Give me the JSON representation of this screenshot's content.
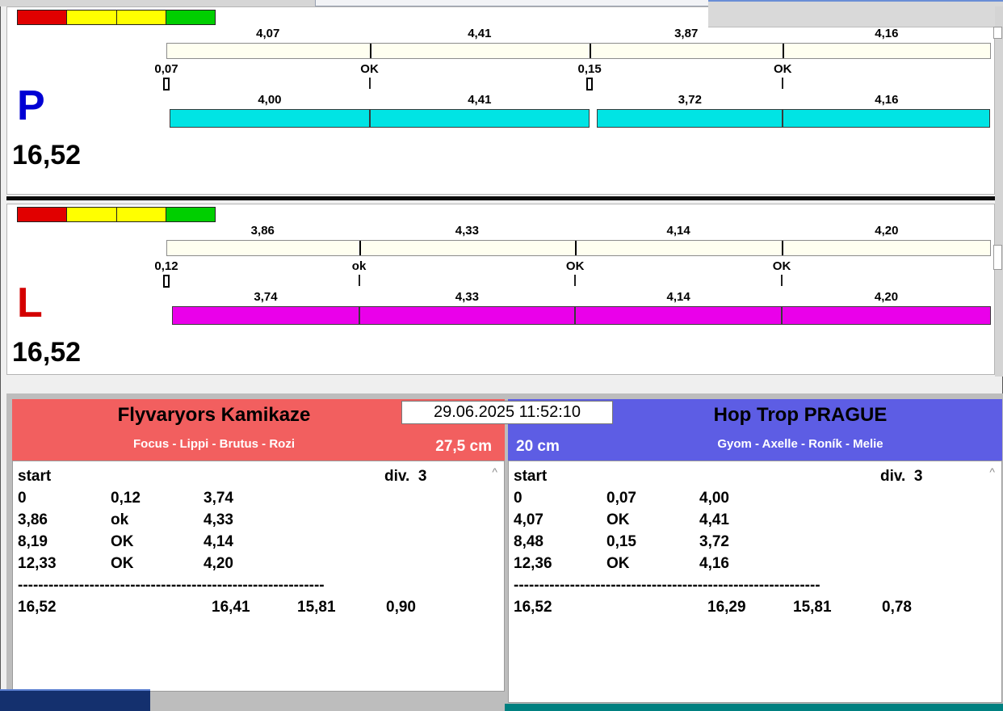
{
  "ui": {
    "light_colors": [
      "#e10000",
      "#ffff00",
      "#ffff00",
      "#00cf00"
    ],
    "caret": "^"
  },
  "lanes": [
    {
      "id": "P",
      "letter": "P",
      "letter_color": "#0000d4",
      "bar_color": "#00e4e4",
      "total_label": "16,52",
      "total_seconds": 16.52,
      "upper": {
        "labels": [
          "4,07",
          "4,41",
          "3,87",
          "4,16"
        ],
        "values": [
          4.07,
          4.41,
          3.87,
          4.16
        ]
      },
      "marks": [
        {
          "label": "0,07",
          "glyph": "box",
          "pos": 0
        },
        {
          "label": "OK",
          "glyph": "tick",
          "pos": 4.07
        },
        {
          "label": "0,15",
          "glyph": "box",
          "pos": 8.48
        },
        {
          "label": "OK",
          "glyph": "tick",
          "pos": 12.35
        }
      ],
      "lower": {
        "labels": [
          "4,00",
          "4,41",
          "3,72",
          "4,16"
        ],
        "segments": [
          [
            0.07,
            4.07
          ],
          [
            4.07,
            8.48
          ],
          [
            8.63,
            12.35
          ],
          [
            12.35,
            16.51
          ]
        ]
      }
    },
    {
      "id": "L",
      "letter": "L",
      "letter_color": "#d40000",
      "bar_color": "#ea00ea",
      "total_label": "16,52",
      "total_seconds": 16.52,
      "upper": {
        "labels": [
          "3,86",
          "4,33",
          "4,14",
          "4,20"
        ],
        "values": [
          3.86,
          4.33,
          4.14,
          4.2
        ]
      },
      "marks": [
        {
          "label": "0,12",
          "glyph": "box",
          "pos": 0
        },
        {
          "label": "ok",
          "glyph": "tick",
          "pos": 3.86
        },
        {
          "label": "OK",
          "glyph": "tick",
          "pos": 8.19
        },
        {
          "label": "OK",
          "glyph": "tick",
          "pos": 12.33
        }
      ],
      "lower": {
        "labels": [
          "3,74",
          "4,33",
          "4,14",
          "4,20"
        ],
        "segments": [
          [
            0.12,
            3.86
          ],
          [
            3.86,
            8.19
          ],
          [
            8.19,
            12.33
          ],
          [
            12.33,
            16.52
          ]
        ]
      }
    }
  ],
  "footer": {
    "timestamp": "29.06.2025 11:52:10",
    "left": {
      "team": "Flyvaryors Kamikaze",
      "dogs": "Focus - Lippi - Brutus - Rozi",
      "height": "27,5 cm",
      "header_color": "#f25f5f",
      "table": {
        "start_label": "start",
        "division": "div.  3",
        "rows": [
          [
            "0",
            "0,12",
            "3,74"
          ],
          [
            "3,86",
            "ok",
            "4,33"
          ],
          [
            "8,19",
            "OK",
            "4,14"
          ],
          [
            "12,33",
            "OK",
            "4,20"
          ]
        ],
        "separator": "------------------------------------------------------------",
        "totals": [
          "16,52",
          "16,41",
          "15,81",
          "0,90"
        ]
      }
    },
    "right": {
      "team": "Hop Trop PRAGUE",
      "dogs": "Gyom - Axelle - Roník - Melie",
      "height": "20 cm",
      "header_color": "#5d5de4",
      "table": {
        "start_label": "start",
        "division": "div.  3",
        "rows": [
          [
            "0",
            "0,07",
            "4,00"
          ],
          [
            "4,07",
            "OK",
            "4,41"
          ],
          [
            "8,48",
            "0,15",
            "3,72"
          ],
          [
            "12,36",
            "OK",
            "4,16"
          ]
        ],
        "separator": "------------------------------------------------------------",
        "totals": [
          "16,52",
          "16,29",
          "15,81",
          "0,78"
        ]
      }
    }
  }
}
